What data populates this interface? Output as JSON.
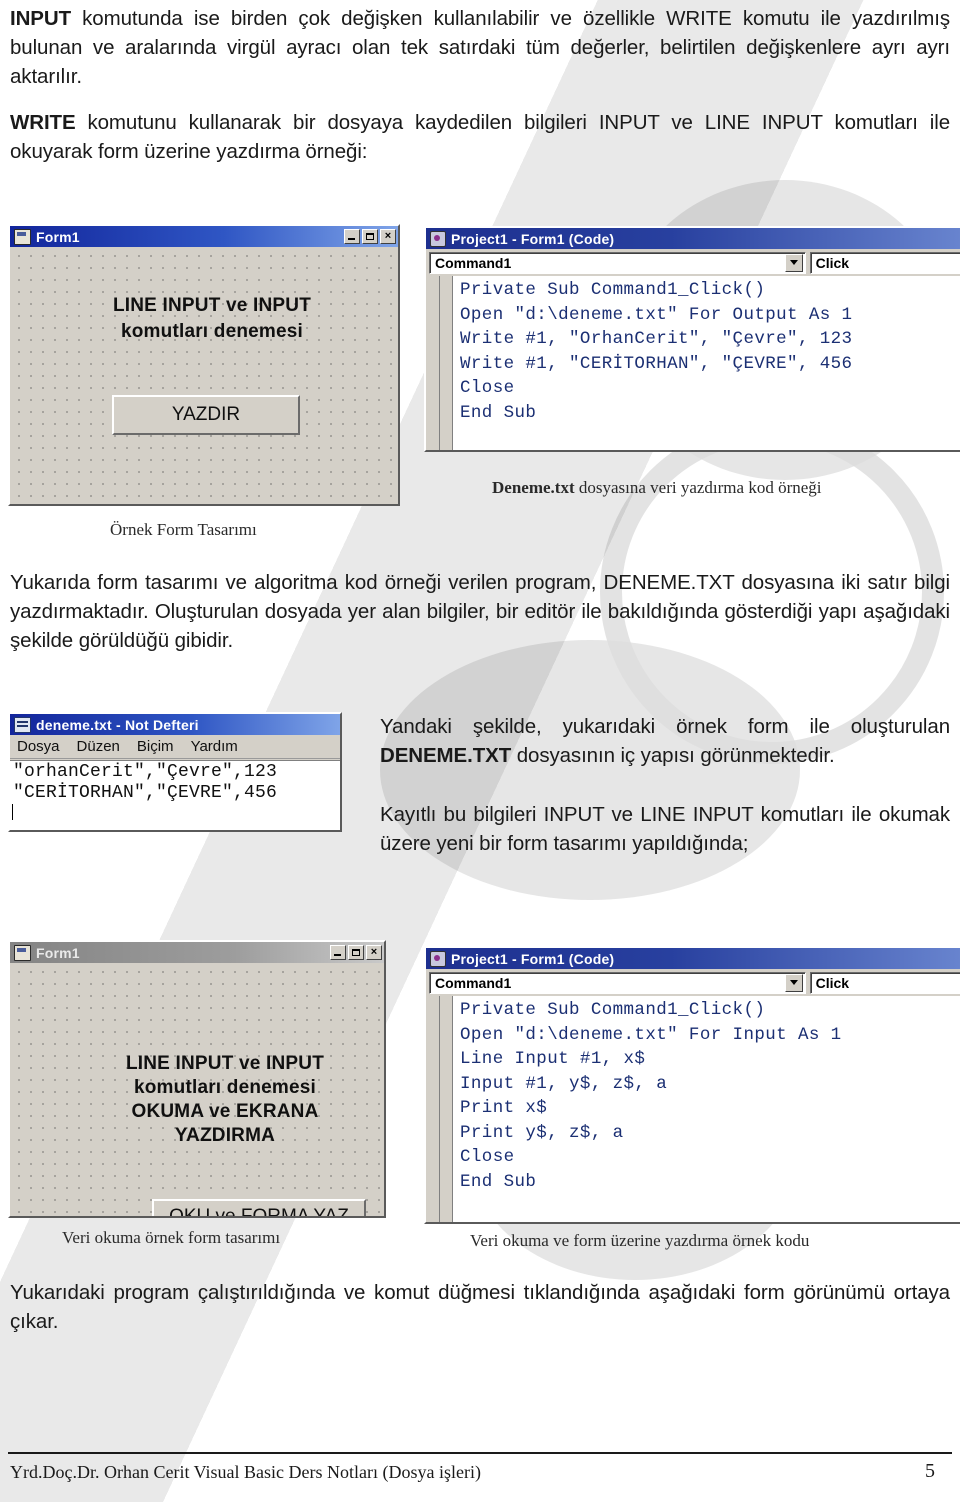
{
  "document": {
    "paragraph_1": {
      "lead": "INPUT",
      "rest": " komutunda ise birden çok değişken kullanılabilir ve özellikle WRITE komutu ile yazdırılmış bulunan ve aralarında virgül ayracı olan tek satırdaki tüm değerler, belirtilen değişkenlere ayrı ayrı aktarılır."
    },
    "paragraph_2": {
      "lead": "WRITE",
      "rest": " komutunu kullanarak bir dosyaya kaydedilen bilgileri INPUT ve LINE INPUT komutları ile okuyarak form üzerine yazdırma örneği:"
    },
    "paragraph_3": "Yukarıda form tasarımı ve algoritma kod örneği verilen program, DENEME.TXT dosyasına iki satır bilgi yazdırmaktadır. Oluşturulan dosyada yer alan bilgiler, bir editör ile bakıldığında gösterdiği yapı aşağıdaki şekilde görüldüğü gibidir.",
    "paragraph_4": {
      "part_a": "Yandaki şekilde, yukarıdaki örnek form ile oluşturulan ",
      "bold": "DENEME.TXT",
      "part_b": " dosyasının iç yapısı görünmektedir.",
      "part_c": "Kayıtlı bu bilgileri INPUT ve LINE INPUT komutları ile okumak üzere yeni bir form tasarımı yapıldığında;"
    },
    "paragraph_5": "Yukarıdaki program çalıştırıldığında ve komut düğmesi tıklandığında aşağıdaki form görünümü ortaya çıkar."
  },
  "captions": {
    "form_design_1": "Örnek Form Tasarımı",
    "code_1_bold": "Deneme.txt",
    "code_1_rest": " dosyasına veri yazdırma kod örneği",
    "form_design_2": "Veri okuma örnek form tasarımı",
    "code_2": "Veri okuma ve form üzerine yazdırma örnek kodu"
  },
  "form_window_1": {
    "title": "Form1",
    "icon": "vb-form-icon",
    "buttons": {
      "minimize": "minimize-icon",
      "maximize": "maximize-icon",
      "close": "×"
    },
    "label_lines": [
      "LINE INPUT ve INPUT",
      "komutları denemesi"
    ],
    "command_button": "YAZDIR"
  },
  "code_window_1": {
    "title": "Project1 - Form1 (Code)",
    "object_combo": "Command1",
    "procedure_combo": "Click",
    "code": "Private Sub Command1_Click()\nOpen \"d:\\deneme.txt\" For Output As 1\nWrite #1, \"OrhanCerit\", \"Çevre\", 123\nWrite #1, \"CERİTORHAN\", \"ÇEVRE\", 456\nClose\nEnd Sub"
  },
  "notepad_window": {
    "title": "deneme.txt - Not Defteri",
    "icon": "notepad-icon",
    "menu": [
      "Dosya",
      "Düzen",
      "Biçim",
      "Yardım"
    ],
    "content": "\"orhanCerit\",\"Çevre\",123\n\"CERİTORHAN\",\"ÇEVRE\",456"
  },
  "form_window_2": {
    "title": "Form1",
    "icon": "vb-form-icon",
    "buttons": {
      "minimize": "minimize-icon",
      "maximize": "maximize-icon",
      "close": "×"
    },
    "label_lines": [
      "LINE INPUT ve INPUT",
      "komutları denemesi",
      "OKUMA ve EKRANA",
      "YAZDIRMA"
    ],
    "command_button": "OKU ve FORMA YAZ"
  },
  "code_window_2": {
    "title": "Project1 - Form1 (Code)",
    "object_combo": "Command1",
    "procedure_combo": "Click",
    "code": "Private Sub Command1_Click()\nOpen \"d:\\deneme.txt\" For Input As 1\nLine Input #1, x$\nInput #1, y$, z$, a\nPrint x$\nPrint y$, z$, a\nClose\nEnd Sub"
  },
  "footer": {
    "text": "Yrd.Doç.Dr. Orhan Cerit Visual Basic Ders Notları   (Dosya işleri)",
    "page_number": "5"
  }
}
